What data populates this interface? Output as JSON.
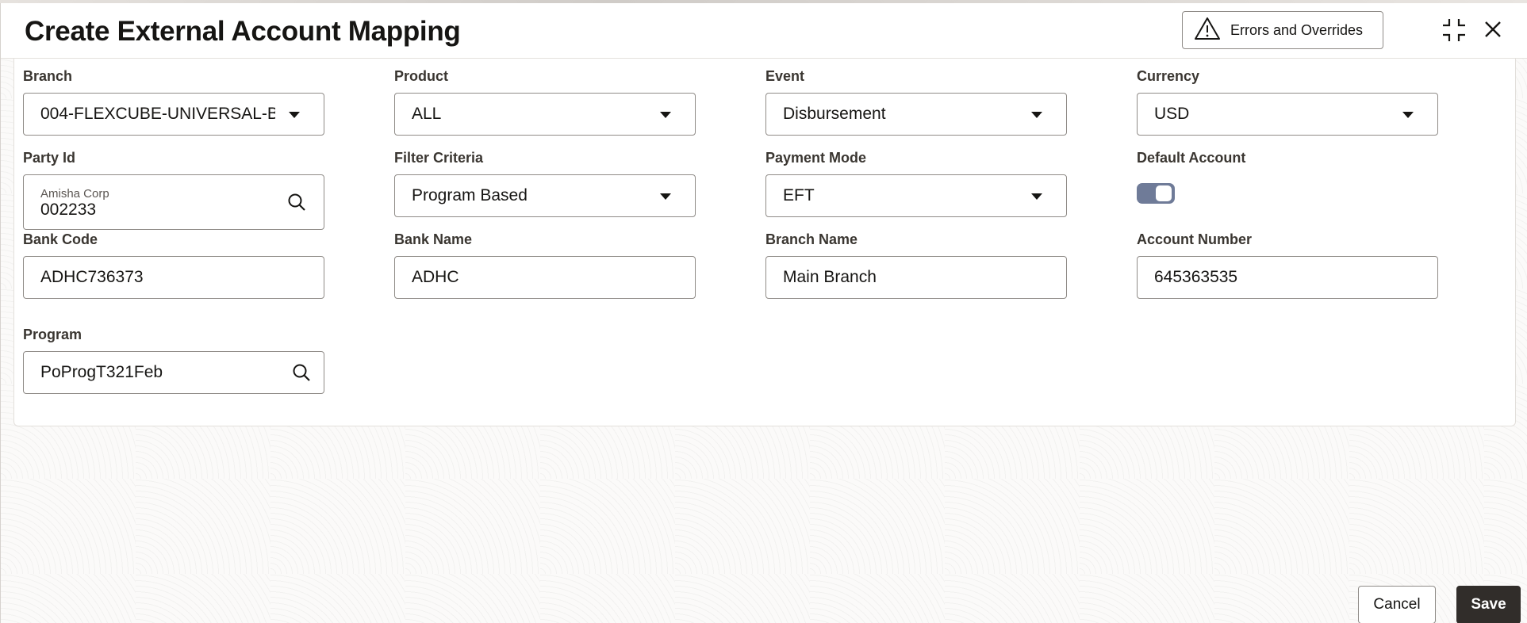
{
  "dialog": {
    "title": "Create External Account Mapping",
    "errors_button_label": "Errors and Overrides"
  },
  "fields": {
    "branch": {
      "label": "Branch",
      "value": "004-FLEXCUBE-UNIVERSAL-B"
    },
    "product": {
      "label": "Product",
      "value": "ALL"
    },
    "event": {
      "label": "Event",
      "value": "Disbursement"
    },
    "currency": {
      "label": "Currency",
      "value": "USD"
    },
    "party_id": {
      "label": "Party Id",
      "name": "Amisha Corp",
      "value": "002233"
    },
    "filter_criteria": {
      "label": "Filter Criteria",
      "value": "Program Based"
    },
    "payment_mode": {
      "label": "Payment Mode",
      "value": "EFT"
    },
    "default_account": {
      "label": "Default Account",
      "checked": true
    },
    "bank_code": {
      "label": "Bank Code",
      "value": "ADHC736373"
    },
    "bank_name": {
      "label": "Bank Name",
      "value": "ADHC"
    },
    "branch_name": {
      "label": "Branch Name",
      "value": "Main Branch"
    },
    "account_number": {
      "label": "Account Number",
      "value": "645363535"
    },
    "program": {
      "label": "Program",
      "value": "PoProgT321Feb"
    }
  },
  "footer": {
    "cancel_label": "Cancel",
    "save_label": "Save"
  },
  "colors": {
    "primary_button": "#312d2a",
    "toggle_on": "#6f7b98",
    "border": "#8f8b87"
  },
  "icons": [
    "warning-icon",
    "collapse-icon",
    "close-icon",
    "chevron-down-icon",
    "search-icon"
  ]
}
